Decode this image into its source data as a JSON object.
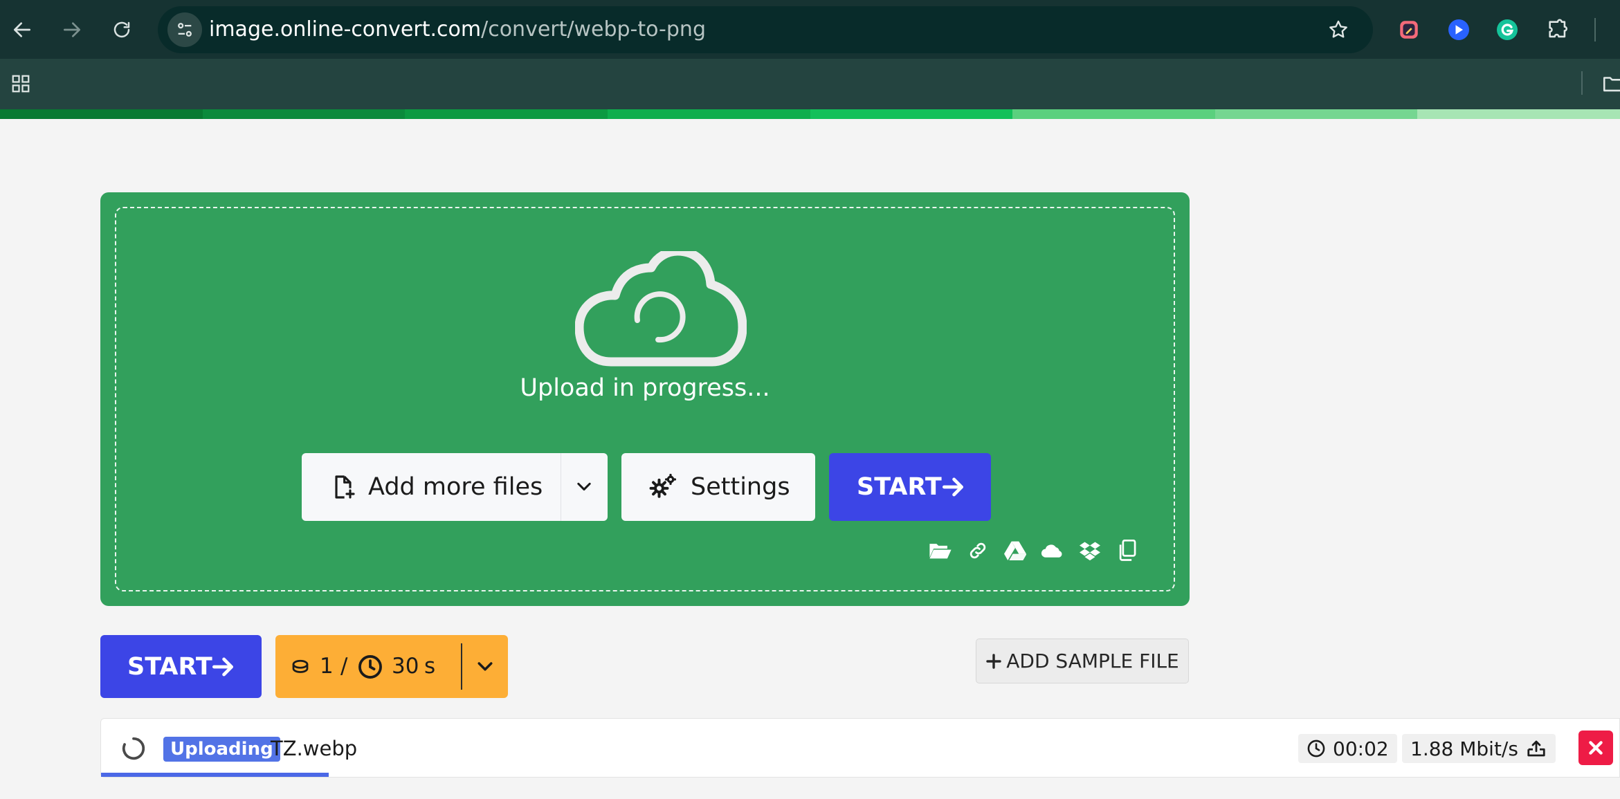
{
  "browser": {
    "url_host": "image.online-convert.com",
    "url_path": "/convert/webp-to-png"
  },
  "upload": {
    "status": "Upload in progress...",
    "add_files_label": "Add more files",
    "settings_label": "Settings",
    "start_label": "START",
    "source_icons": [
      "folder-open-icon",
      "link-icon",
      "google-drive-icon",
      "onedrive-icon",
      "dropbox-icon",
      "clipboard-icon"
    ]
  },
  "controls": {
    "start_label": "START",
    "credits_value": "1",
    "credits_separator": "/",
    "time_value": "30",
    "time_unit": "s",
    "sample_label": "ADD SAMPLE FILE"
  },
  "file": {
    "status_badge": "Uploading",
    "name": "TZ.webp",
    "elapsed": "00:02",
    "speed": "1.88 Mbit/s",
    "progress_fraction": 0.15
  },
  "colors": {
    "drop_zone": "#32a05c",
    "primary": "#3c45e6",
    "credits": "#fdae36",
    "danger": "#ee1c46",
    "progress_strip": [
      "#087a32",
      "#0b8a3c",
      "#0c9a42",
      "#0fae4d",
      "#13c05a",
      "#5bd07e",
      "#75d691",
      "#a7e5b4"
    ]
  }
}
